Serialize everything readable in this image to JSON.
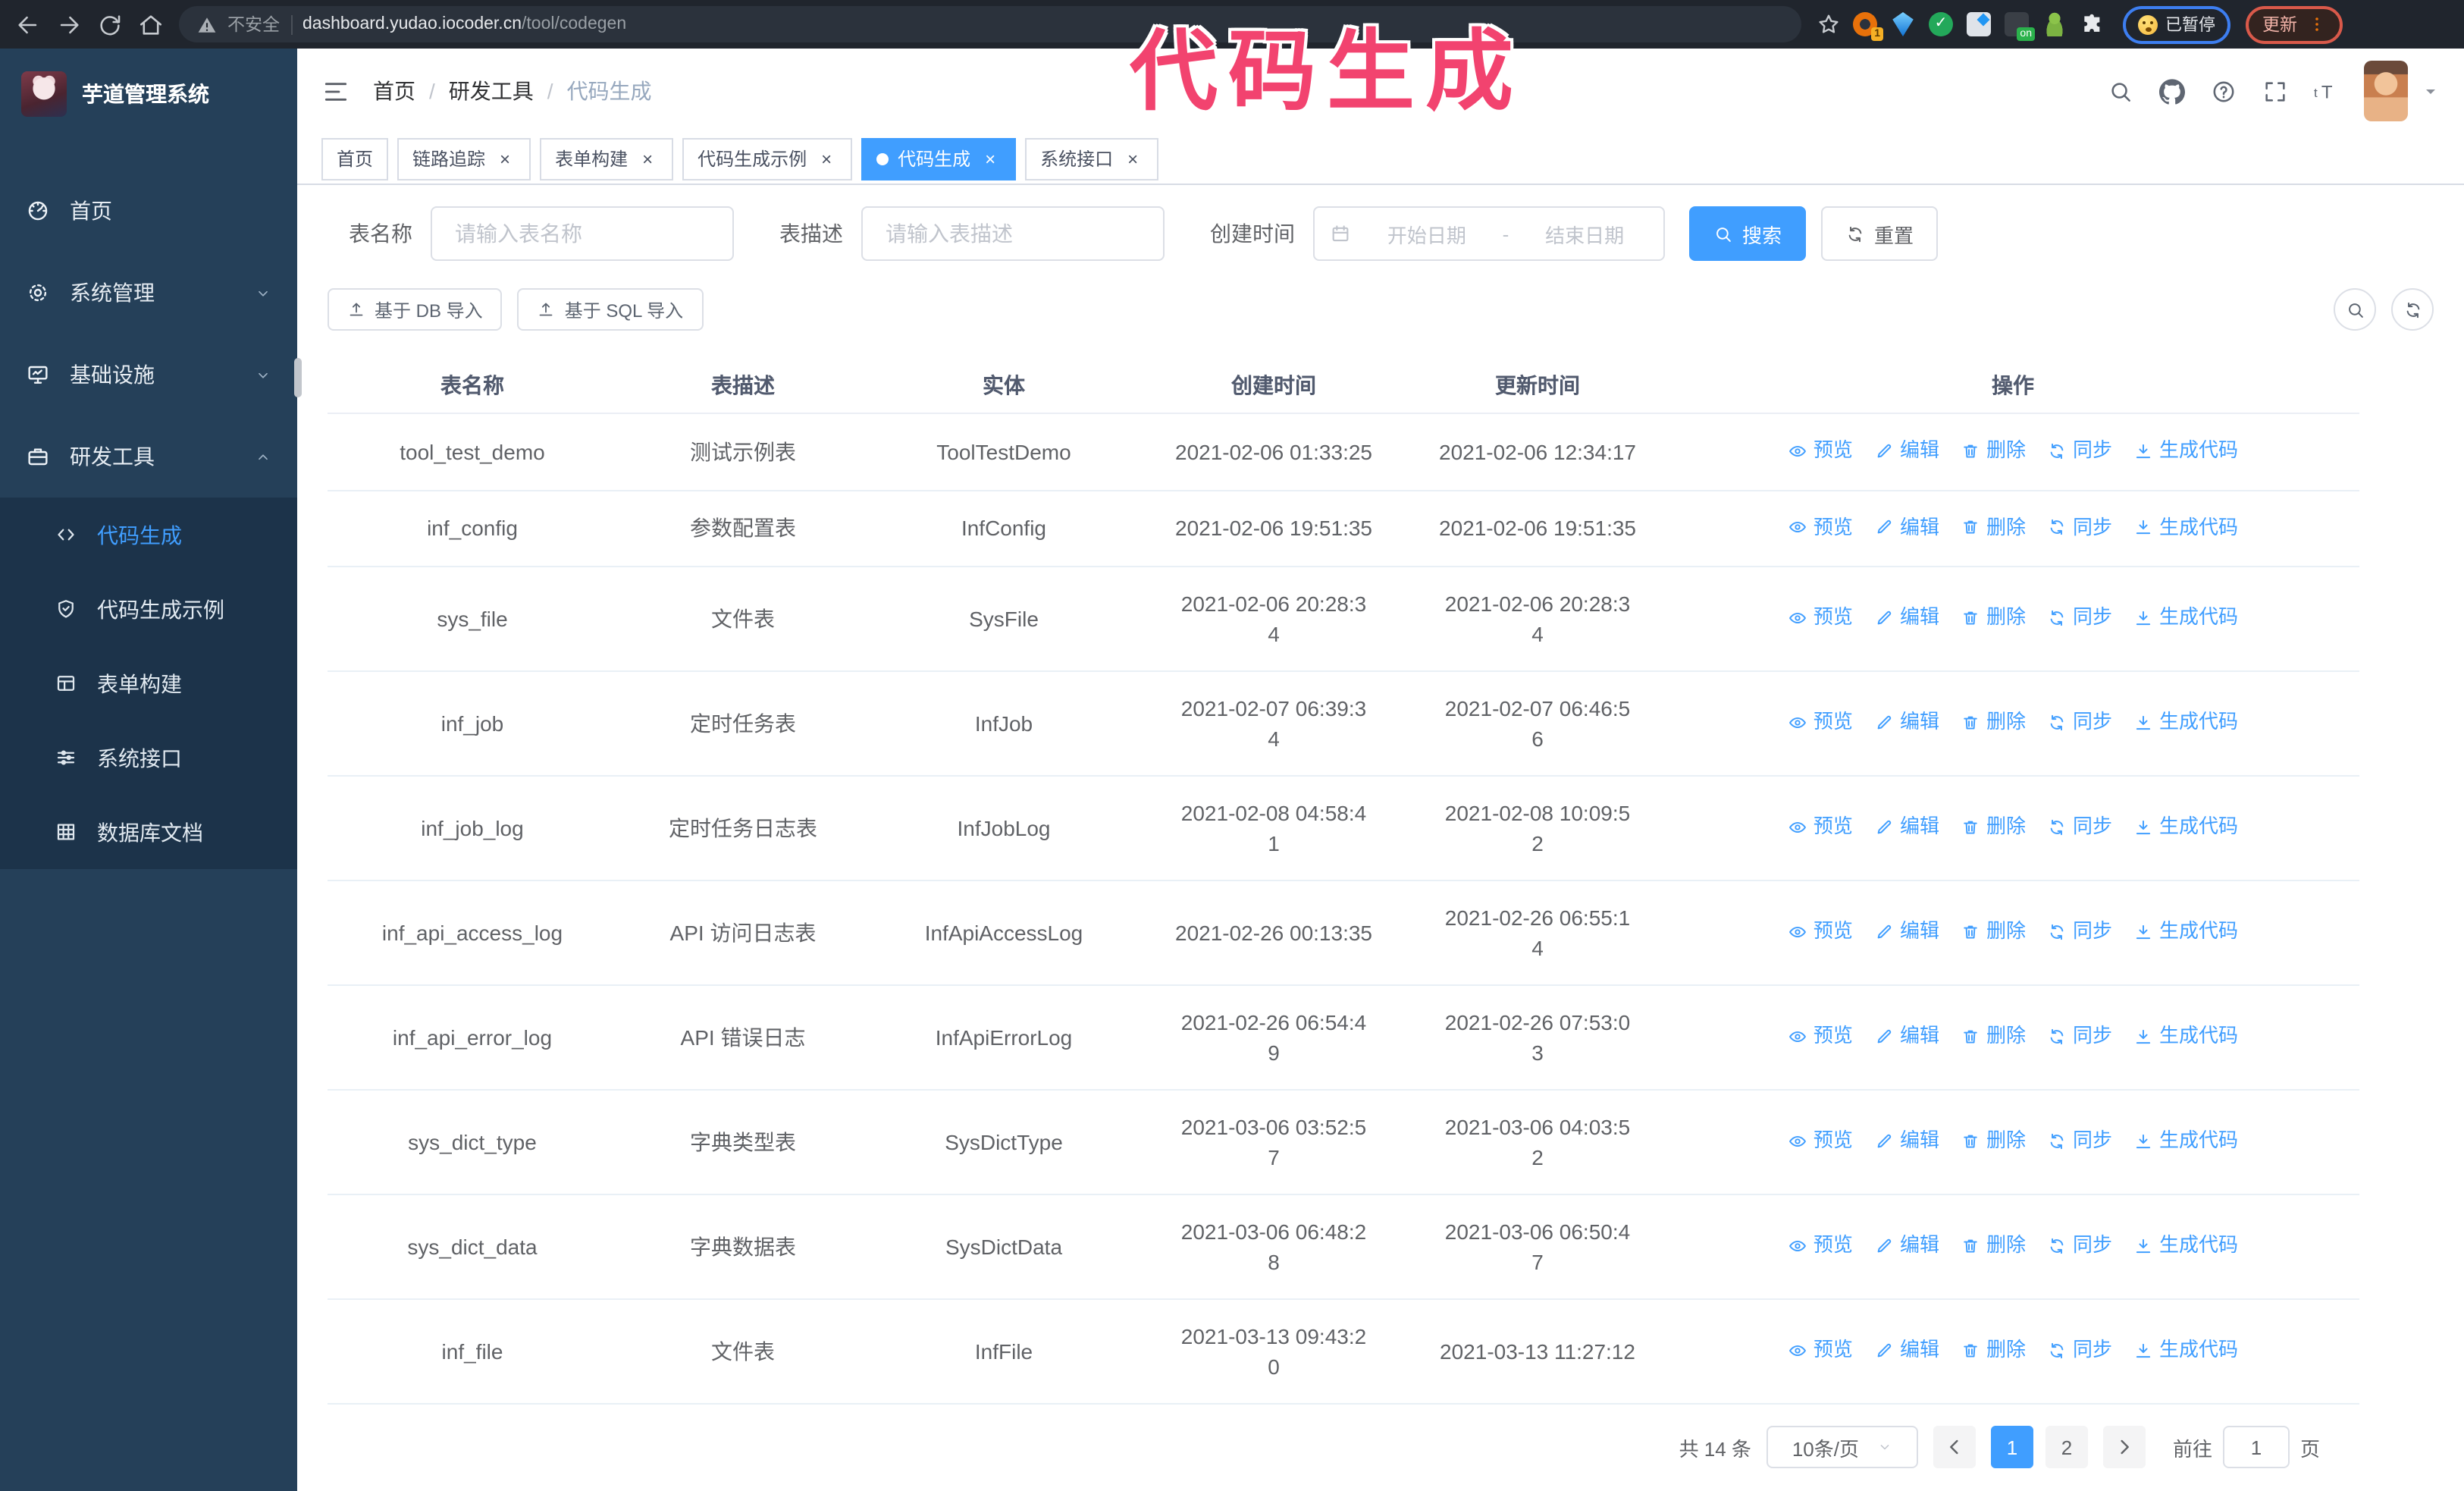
{
  "browser": {
    "nav": [
      "back-icon",
      "forward-icon",
      "reload-icon",
      "home-icon"
    ],
    "security_label": "不安全",
    "url_host": "dashboard.yudao.iocoder.cn",
    "url_path": "/tool/codegen",
    "bookmark_icon": "star-icon",
    "extensions": [
      {
        "icon": "orange-circle-icon",
        "badge": "1"
      },
      {
        "icon": "blue-gem-icon"
      },
      {
        "icon": "green-check-icon",
        "glyph": "✓"
      },
      {
        "icon": "grid-ext-icon"
      },
      {
        "icon": "dark-on-icon",
        "badge": "on"
      },
      {
        "icon": "green-man-icon"
      },
      {
        "icon": "puzzle-ext-icon"
      }
    ],
    "paused_badge": {
      "icon": "surprised-face-icon",
      "label": "已暂停"
    },
    "update_button": {
      "label": "更新",
      "menu_icon": "kebab-icon"
    }
  },
  "annotation": {
    "text": "代码生成",
    "color": "#f2436f"
  },
  "sidebar": {
    "logo_title": "芋道管理系统",
    "items": [
      {
        "label": "首页",
        "icon": "gauge-icon",
        "chevron": ""
      },
      {
        "label": "系统管理",
        "icon": "gear-icon",
        "chevron": "down"
      },
      {
        "label": "基础设施",
        "icon": "monitor-icon",
        "chevron": "down"
      },
      {
        "label": "研发工具",
        "icon": "toolbox-icon",
        "chevron": "up",
        "expanded": true
      }
    ],
    "sub_items": [
      {
        "label": "代码生成",
        "icon": "code-icon",
        "active": true
      },
      {
        "label": "代码生成示例",
        "icon": "shield-icon",
        "active": false
      },
      {
        "label": "表单构建",
        "icon": "form-icon",
        "active": false
      },
      {
        "label": "系统接口",
        "icon": "sliders-icon",
        "active": false
      },
      {
        "label": "数据库文档",
        "icon": "grid-icon",
        "active": false
      }
    ]
  },
  "header": {
    "collapse_icon": "menu-fold-icon",
    "breadcrumb": [
      "首页",
      "研发工具",
      "代码生成"
    ],
    "actions": [
      "search-icon",
      "github-icon",
      "question-icon",
      "fullscreen-icon",
      "font-size-icon"
    ],
    "caret_icon": "caret-down-icon"
  },
  "tabs": [
    {
      "label": "首页",
      "closable": false,
      "active": false
    },
    {
      "label": "链路追踪",
      "closable": true,
      "active": false
    },
    {
      "label": "表单构建",
      "closable": true,
      "active": false
    },
    {
      "label": "代码生成示例",
      "closable": true,
      "active": false
    },
    {
      "label": "代码生成",
      "closable": true,
      "active": true
    },
    {
      "label": "系统接口",
      "closable": true,
      "active": false
    }
  ],
  "filters": {
    "table_name_label": "表名称",
    "table_name_placeholder": "请输入表名称",
    "table_desc_label": "表描述",
    "table_desc_placeholder": "请输入表描述",
    "create_time_label": "创建时间",
    "date_start_placeholder": "开始日期",
    "date_separator": "-",
    "date_end_placeholder": "结束日期",
    "search_button": "搜索",
    "reset_button": "重置"
  },
  "toolbar": {
    "import_db": "基于 DB 导入",
    "import_sql": "基于 SQL 导入",
    "import_icon": "upload-icon",
    "tools": [
      "search-icon",
      "refresh-icon"
    ]
  },
  "table": {
    "columns": [
      "表名称",
      "表描述",
      "实体",
      "创建时间",
      "更新时间",
      "操作"
    ],
    "ops": [
      {
        "label": "预览",
        "icon": "eye-icon"
      },
      {
        "label": "编辑",
        "icon": "edit-icon"
      },
      {
        "label": "删除",
        "icon": "delete-icon"
      },
      {
        "label": "同步",
        "icon": "sync-icon"
      },
      {
        "label": "生成代码",
        "icon": "download-icon"
      }
    ],
    "rows": [
      {
        "name": "tool_test_demo",
        "desc": "测试示例表",
        "entity": "ToolTestDemo",
        "created": "2021-02-06 01:33:25",
        "created_wrap": false,
        "updated": "2021-02-06 12:34:17",
        "updated_wrap": false
      },
      {
        "name": "inf_config",
        "desc": "参数配置表",
        "entity": "InfConfig",
        "created": "2021-02-06 19:51:35",
        "created_wrap": false,
        "updated": "2021-02-06 19:51:35",
        "updated_wrap": false
      },
      {
        "name": "sys_file",
        "desc": "文件表",
        "entity": "SysFile",
        "created": "2021-02-06 20:28:34",
        "created_wrap": true,
        "updated": "2021-02-06 20:28:34",
        "updated_wrap": true
      },
      {
        "name": "inf_job",
        "desc": "定时任务表",
        "entity": "InfJob",
        "created": "2021-02-07 06:39:34",
        "created_wrap": true,
        "updated": "2021-02-07 06:46:56",
        "updated_wrap": true
      },
      {
        "name": "inf_job_log",
        "desc": "定时任务日志表",
        "entity": "InfJobLog",
        "created": "2021-02-08 04:58:41",
        "created_wrap": true,
        "updated": "2021-02-08 10:09:52",
        "updated_wrap": true
      },
      {
        "name": "inf_api_access_log",
        "desc": "API 访问日志表",
        "entity": "InfApiAccessLog",
        "created": "2021-02-26 00:13:35",
        "created_wrap": false,
        "updated": "2021-02-26 06:55:14",
        "updated_wrap": true
      },
      {
        "name": "inf_api_error_log",
        "desc": "API 错误日志",
        "entity": "InfApiErrorLog",
        "created": "2021-02-26 06:54:49",
        "created_wrap": true,
        "updated": "2021-02-26 07:53:03",
        "updated_wrap": true
      },
      {
        "name": "sys_dict_type",
        "desc": "字典类型表",
        "entity": "SysDictType",
        "created": "2021-03-06 03:52:57",
        "created_wrap": true,
        "updated": "2021-03-06 04:03:52",
        "updated_wrap": true
      },
      {
        "name": "sys_dict_data",
        "desc": "字典数据表",
        "entity": "SysDictData",
        "created": "2021-03-06 06:48:28",
        "created_wrap": true,
        "updated": "2021-03-06 06:50:47",
        "updated_wrap": true
      },
      {
        "name": "inf_file",
        "desc": "文件表",
        "entity": "InfFile",
        "created": "2021-03-13 09:43:20",
        "created_wrap": true,
        "updated": "2021-03-13 11:27:12",
        "updated_wrap": false
      }
    ]
  },
  "pagination": {
    "total": "共 14 条",
    "page_size": "10条/页",
    "prev_icon": "arrow-left-icon",
    "next_icon": "arrow-right-icon",
    "pages": [
      "1",
      "2"
    ],
    "active_page": "1",
    "goto_label": "前往",
    "goto_value": "1",
    "goto_unit": "页"
  },
  "colors": {
    "accent": "#409EFF",
    "annotation": "#F2436F",
    "sidebar_bg": "#254059",
    "submenu_bg": "#1C334A",
    "browser_bar": "#20252D",
    "tab_border": "#D8DCE5"
  }
}
